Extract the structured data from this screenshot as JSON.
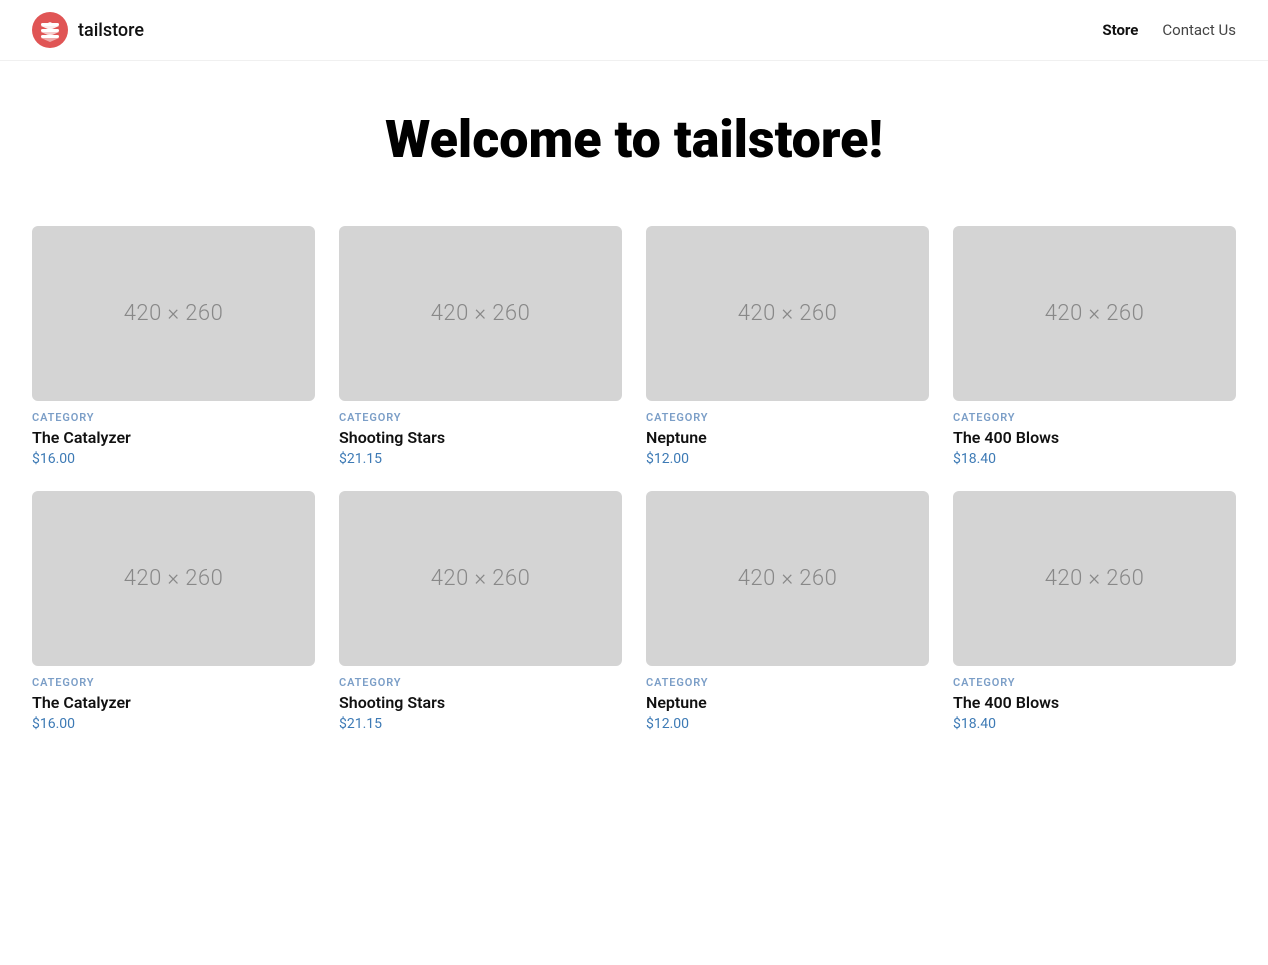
{
  "header": {
    "logo_text": "tailstore",
    "nav": {
      "store_label": "Store",
      "contact_label": "Contact Us"
    }
  },
  "hero": {
    "title": "Welcome to tailstore!"
  },
  "products": [
    {
      "id": 1,
      "category": "CATEGORY",
      "name": "The Catalyzer",
      "price": "$16.00",
      "image_label": "420 × 260"
    },
    {
      "id": 2,
      "category": "CATEGORY",
      "name": "Shooting Stars",
      "price": "$21.15",
      "image_label": "420 × 260"
    },
    {
      "id": 3,
      "category": "CATEGORY",
      "name": "Neptune",
      "price": "$12.00",
      "image_label": "420 × 260"
    },
    {
      "id": 4,
      "category": "CATEGORY",
      "name": "The 400 Blows",
      "price": "$18.40",
      "image_label": "420 × 260"
    },
    {
      "id": 5,
      "category": "CATEGORY",
      "name": "The Catalyzer",
      "price": "$16.00",
      "image_label": "420 × 260"
    },
    {
      "id": 6,
      "category": "CATEGORY",
      "name": "Shooting Stars",
      "price": "$21.15",
      "image_label": "420 × 260"
    },
    {
      "id": 7,
      "category": "CATEGORY",
      "name": "Neptune",
      "price": "$12.00",
      "image_label": "420 × 260"
    },
    {
      "id": 8,
      "category": "CATEGORY",
      "name": "The 400 Blows",
      "price": "$18.40",
      "image_label": "420 × 260"
    }
  ]
}
